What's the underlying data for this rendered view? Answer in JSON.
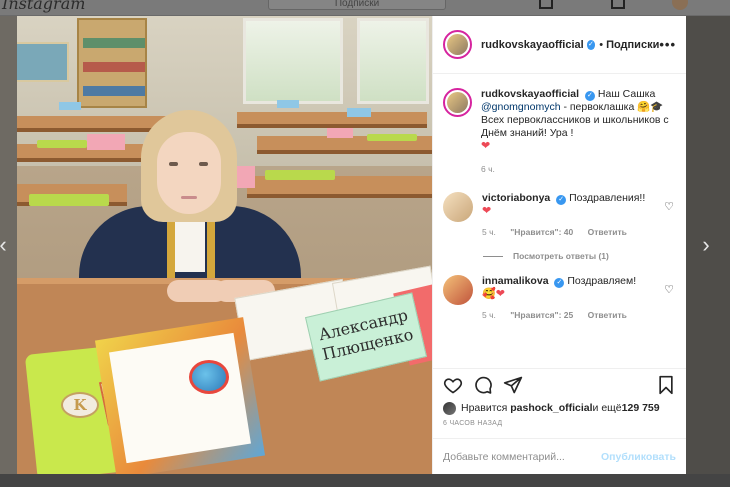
{
  "background": {
    "logo_text": "Instagram",
    "search_text": "Подписки"
  },
  "post": {
    "author": "rudkovskayaofficial",
    "follow_label": "Подписки",
    "more_label": "•••",
    "nameplate_line1": "Александр",
    "nameplate_line2": "Плющенко",
    "caption": {
      "username": "rudkovskayaofficial",
      "text_before": "Наш Сашка ",
      "mention": "@gnomgnomych",
      "text_after": " - первоклашка 🤗🎓 Всех первоклассников и школьников с Днём знаний! Ура !",
      "emoji_end": "❤",
      "time": "6 ч."
    },
    "comments": [
      {
        "username": "victoriabonya",
        "text": "Поздравления!!",
        "emoji": "❤",
        "time": "5 ч.",
        "likes": "\"Нравится\": 40",
        "reply": "Ответить"
      },
      {
        "username": "innamalikova",
        "text": "Поздравляем!",
        "emoji": "🥰❤",
        "time": "5 ч.",
        "likes": "\"Нравится\": 25",
        "reply": "Ответить"
      }
    ],
    "view_replies": "Посмотреть ответы (1)",
    "liked_by_prefix": "Нравится ",
    "liked_by_user": "pashock_official",
    "liked_by_suffix": " и ещё ",
    "liked_by_count": "129 759",
    "time_ago": "6 ЧАСОВ НАЗАД",
    "comment_placeholder": "Добавьте комментарий...",
    "publish_label": "Опубликовать"
  },
  "icons": {
    "nav_left": "chevron-left-icon",
    "nav_right": "chevron-right-icon",
    "like": "heart-icon",
    "comment": "comment-icon",
    "share": "paper-plane-icon",
    "save": "bookmark-icon"
  },
  "colors": {
    "verified": "#3897f0",
    "heart": "#ed4956",
    "publish_disabled": "#b2dffc",
    "story_ring": "#d6249f"
  }
}
